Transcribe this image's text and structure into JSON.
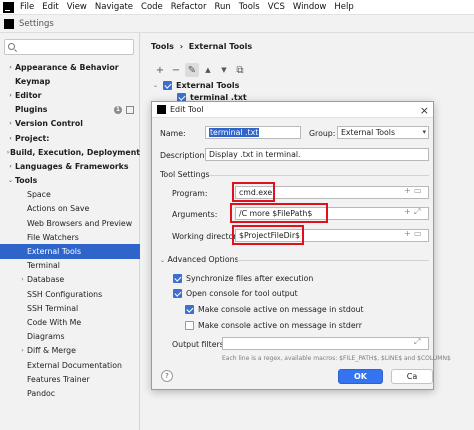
{
  "menubar": {
    "items": [
      "File",
      "Edit",
      "View",
      "Navigate",
      "Code",
      "Refactor",
      "Run",
      "Tools",
      "VCS",
      "Window",
      "Help"
    ]
  },
  "window": {
    "title": "Settings"
  },
  "search": {
    "placeholder": "Q▾"
  },
  "sidebar": {
    "items": [
      {
        "label": "Appearance & Behavior",
        "arrow": "›",
        "bold": true
      },
      {
        "label": "Keymap",
        "arrow": "",
        "bold": true
      },
      {
        "label": "Editor",
        "arrow": "›",
        "bold": true
      },
      {
        "label": "Plugins",
        "arrow": "",
        "bold": true,
        "badge": "1"
      },
      {
        "label": "Version Control",
        "arrow": "›",
        "bold": true
      },
      {
        "label": "Project:",
        "arrow": "›",
        "bold": true
      },
      {
        "label": "Build, Execution, Deployment",
        "arrow": "›",
        "bold": true
      },
      {
        "label": "Languages & Frameworks",
        "arrow": "›",
        "bold": true
      },
      {
        "label": "Tools",
        "arrow": "⌄",
        "bold": true
      },
      {
        "label": "Space",
        "indent": 1
      },
      {
        "label": "Actions on Save",
        "indent": 1
      },
      {
        "label": "Web Browsers and Preview",
        "indent": 1
      },
      {
        "label": "File Watchers",
        "indent": 1
      },
      {
        "label": "External Tools",
        "indent": 1,
        "selected": true
      },
      {
        "label": "Terminal",
        "indent": 1
      },
      {
        "label": "Database",
        "indent": 1,
        "arrow": "›"
      },
      {
        "label": "SSH Configurations",
        "indent": 1
      },
      {
        "label": "SSH Terminal",
        "indent": 1
      },
      {
        "label": "Code With Me",
        "indent": 1
      },
      {
        "label": "Diagrams",
        "indent": 1
      },
      {
        "label": "Diff & Merge",
        "indent": 1,
        "arrow": "›"
      },
      {
        "label": "External Documentation",
        "indent": 1
      },
      {
        "label": "Features Trainer",
        "indent": 1
      },
      {
        "label": "Pandoc",
        "indent": 1
      }
    ]
  },
  "breadcrumb": {
    "parent": "Tools",
    "sep": "›",
    "current": "External Tools"
  },
  "toolbar": {
    "add": "+",
    "remove": "−",
    "edit": "✎",
    "up": "▲",
    "down": "▼",
    "copy": "⧉"
  },
  "ext_tree": {
    "group": "External Tools",
    "tool": "terminal .txt"
  },
  "dialog": {
    "title": "Edit Tool",
    "close": "×",
    "name_label": "Name:",
    "name_value": "terminal .txt",
    "group_label": "Group:",
    "group_value": "External Tools",
    "description_label": "Description:",
    "description_value": "Display .txt in terminal.",
    "tool_settings_label": "Tool Settings",
    "program_label": "Program:",
    "program_value": "cmd.exe",
    "arguments_label": "Arguments:",
    "arguments_value": "/C more $FilePath$",
    "workdir_label": "Working directory:",
    "workdir_value": "$ProjectFileDir$",
    "advanced_label": "Advanced Options",
    "sync_label": "Synchronize files after execution",
    "console_label": "Open console for tool output",
    "stdout_label": "Make console active on message in stdout",
    "stderr_label": "Make console active on message in stderr",
    "output_filters_label": "Output filters:",
    "hint": "Each line is a regex, available macros: $FILE_PATH$, $LINE$ and $COLUMN$",
    "ok_label": "OK",
    "cancel_label": "Ca",
    "help_label": "?",
    "plus": "+",
    "folder": "▭",
    "expand": "⤢"
  },
  "colors": {
    "accent": "#2f65ca",
    "highlight": "#e0101c",
    "primary_button": "#3574f0"
  }
}
